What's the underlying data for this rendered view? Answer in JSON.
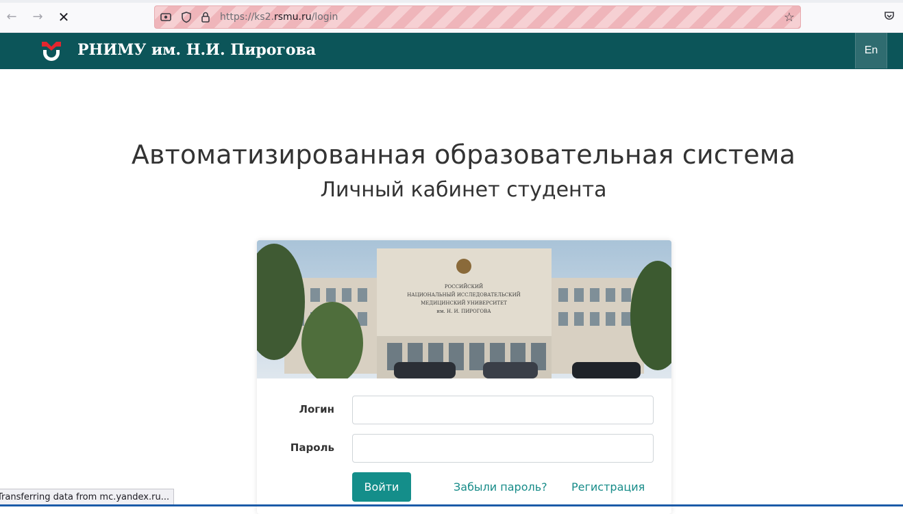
{
  "browser": {
    "back_icon": "arrow-left-icon",
    "forward_icon": "arrow-right-icon",
    "stop_icon": "close-icon",
    "url_prefix": "https://ks2.",
    "url_domain": "rsmu.ru",
    "url_path": "/login"
  },
  "header": {
    "site_title": "РНИМУ им. Н.И. Пирогова",
    "lang_button": "En",
    "bg_color": "#0c5559",
    "logo_color": "#e3262f"
  },
  "main": {
    "title": "Автоматизированная образовательная система",
    "subtitle": "Личный кабинет студента"
  },
  "card": {
    "photo": {
      "sign_line1": "РОССИЙСКИЙ",
      "sign_line2": "НАЦИОНАЛЬНЫЙ ИССЛЕДОВАТЕЛЬСКИЙ",
      "sign_line3": "МЕДИЦИНСКИЙ УНИВЕРСИТЕТ",
      "sign_line4": "им. Н. И. ПИРОГОВА"
    },
    "login_label": "Логин",
    "login_value": "",
    "password_label": "Пароль",
    "password_value": "",
    "submit_label": "Войти",
    "forgot_link": "Забыли пароль?",
    "register_link": "Регистрация",
    "accent_color": "#148e8a"
  },
  "status": {
    "text": "Transferring data from mc.yandex.ru..."
  }
}
